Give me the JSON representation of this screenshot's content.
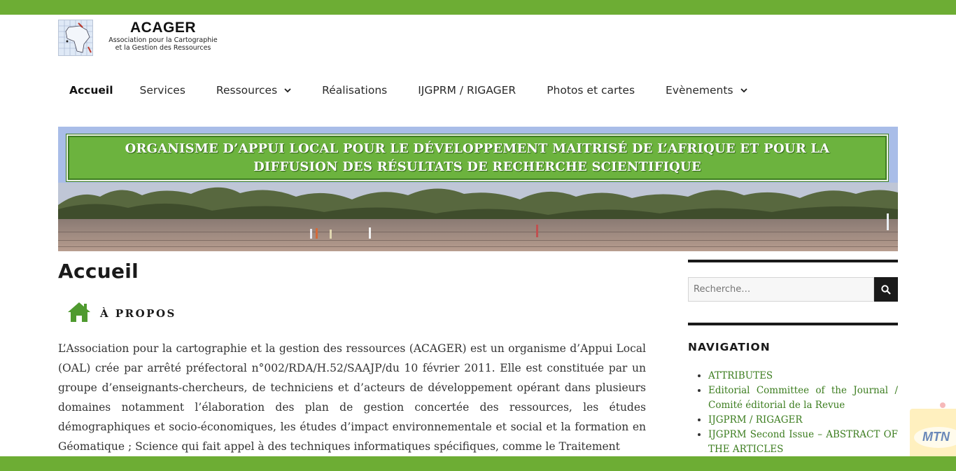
{
  "colors": {
    "brand_green": "#6dad34",
    "link_green": "#3c7d1f",
    "dark": "#1a1a1a"
  },
  "site": {
    "logo_title": "ACAGER",
    "logo_sub_line1": "Association pour la Cartographie",
    "logo_sub_line2": "et la Gestion des Ressources"
  },
  "nav": {
    "items": [
      {
        "label": "Accueil",
        "active": true
      },
      {
        "label": "Services"
      },
      {
        "label": "Ressources",
        "has_dropdown": true
      },
      {
        "label": "Réalisations"
      },
      {
        "label": "IJGPRM / RIGAGER"
      },
      {
        "label": "Photos et cartes"
      },
      {
        "label": "Evènements",
        "has_dropdown": true
      }
    ]
  },
  "banner": {
    "line1": "ORGANISME D’APPUI LOCAL POUR LE DÉVELOPPEMENT MAITRISÉ DE L’AFRIQUE ET POUR LA",
    "line2": "DIFFUSION DES RÉSULTATS DE RECHERCHE SCIENTIFIQUE"
  },
  "main": {
    "page_title": "Accueil",
    "about_icon": "home-icon",
    "about_label": "À PROPOS",
    "body": "L’Association pour la cartographie et la gestion des ressources (ACAGER) est un organisme d’Appui Local (OAL) crée par arrêté préfectoral n°002/RDA/H.52/SAAJP/du 10 février 2011. Elle est constituée par un groupe d’enseignants-chercheurs, de techniciens et d’acteurs de développement opérant dans plusieurs domaines notamment l’élaboration des plan de gestion concertée des ressources, les études démographiques et socio-économiques, les études d’impact environnementale et social et la formation en Géomatique ; Science qui fait appel à des techniques informatiques spécifiques, comme le Traitement"
  },
  "sidebar": {
    "search_placeholder": "Recherche…",
    "search_icon": "search-icon",
    "nav_heading": "NAVIGATION",
    "links": [
      "ATTRIBUTES",
      "Editorial Committee of the Journal / Comité éditorial de la Revue",
      "IJGPRM / RIGAGER",
      "IJGPRM Second Issue – ABSTRACT OF THE ARTICLES"
    ]
  },
  "ad": {
    "text": "MTN"
  }
}
